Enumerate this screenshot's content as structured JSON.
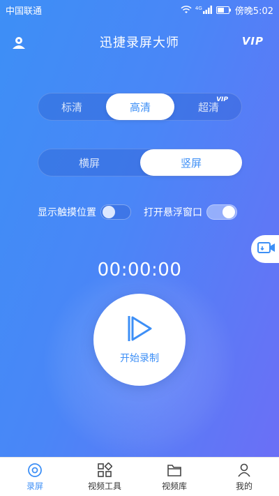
{
  "status_bar": {
    "carrier": "中国联通",
    "signal_label": "4G",
    "time": "傍晚5:02",
    "icons": [
      "wifi-icon",
      "signal-icon",
      "battery-icon"
    ]
  },
  "header": {
    "title": "迅捷录屏大师",
    "user_icon": "user-icon",
    "vip_label": "VIP"
  },
  "quality": {
    "options": [
      "标清",
      "高清",
      "超清"
    ],
    "selected": "高清",
    "vip_tag": "VIP"
  },
  "orientation": {
    "options": [
      "横屏",
      "竖屏"
    ],
    "selected": "竖屏"
  },
  "toggles": {
    "show_touch_label": "显示触摸位置",
    "show_touch_on": false,
    "floating_window_label": "打开悬浮窗口",
    "floating_window_on": true
  },
  "timer": "00:00:00",
  "record": {
    "label": "开始录制",
    "icon": "play-icon"
  },
  "float_button_icon": "video-camera-icon",
  "bottom_nav": {
    "items": [
      {
        "label": "录屏",
        "icon": "record-disc-icon",
        "active": true
      },
      {
        "label": "视频工具",
        "icon": "tools-grid-icon",
        "active": false
      },
      {
        "label": "视频库",
        "icon": "folder-icon",
        "active": false
      },
      {
        "label": "我的",
        "icon": "profile-icon",
        "active": false
      }
    ]
  },
  "colors": {
    "primary": "#3d8ff6",
    "gradient_end": "#6b6ff6"
  }
}
